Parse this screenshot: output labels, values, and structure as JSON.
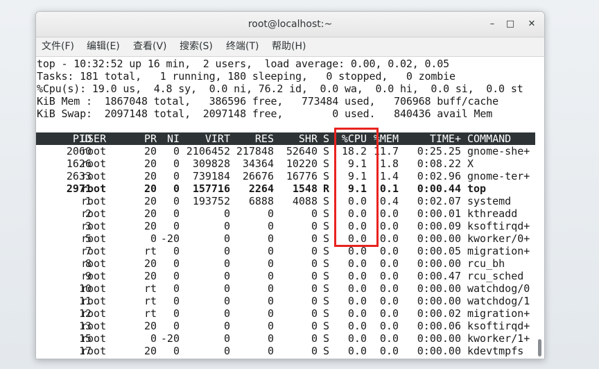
{
  "window": {
    "title": "root@localhost:~",
    "minimize_glyph": "–",
    "maximize_glyph": "□",
    "close_glyph": "✕"
  },
  "menu": [
    {
      "label": "文件(F)"
    },
    {
      "label": "编辑(E)"
    },
    {
      "label": "查看(V)"
    },
    {
      "label": "搜索(S)"
    },
    {
      "label": "终端(T)"
    },
    {
      "label": "帮助(H)"
    }
  ],
  "summary": [
    "top - 10:32:52 up 16 min,  2 users,  load average: 0.00, 0.02, 0.05",
    "Tasks: 181 total,   1 running, 180 sleeping,   0 stopped,   0 zombie",
    "%Cpu(s): 19.0 us,  4.8 sy,  0.0 ni, 76.2 id,  0.0 wa,  0.0 hi,  0.0 si,  0.0 st",
    "KiB Mem :  1867048 total,   386596 free,   773484 used,   706968 buff/cache",
    "KiB Swap:  2097148 total,  2097148 free,        0 used.   840436 avail Mem"
  ],
  "columns": [
    "PID",
    "USER",
    "PR",
    "NI",
    "VIRT",
    "RES",
    "SHR",
    "S",
    "%CPU",
    "%MEM",
    "TIME+",
    "COMMAND"
  ],
  "processes": [
    {
      "pid": "2060",
      "user": "root",
      "pr": "20",
      "ni": "0",
      "virt": "2106452",
      "res": "217848",
      "shr": "52640",
      "s": "S",
      "cpu": "18.2",
      "mem": "11.7",
      "time": "0:25.25",
      "cmd": "gnome-she+",
      "bold": false
    },
    {
      "pid": "1626",
      "user": "root",
      "pr": "20",
      "ni": "0",
      "virt": "309828",
      "res": "34364",
      "shr": "10220",
      "s": "S",
      "cpu": "9.1",
      "mem": "1.8",
      "time": "0:08.22",
      "cmd": "X",
      "bold": false
    },
    {
      "pid": "2633",
      "user": "root",
      "pr": "20",
      "ni": "0",
      "virt": "739184",
      "res": "26676",
      "shr": "16776",
      "s": "S",
      "cpu": "9.1",
      "mem": "1.4",
      "time": "0:02.96",
      "cmd": "gnome-ter+",
      "bold": false
    },
    {
      "pid": "2971",
      "user": "root",
      "pr": "20",
      "ni": "0",
      "virt": "157716",
      "res": "2264",
      "shr": "1548",
      "s": "R",
      "cpu": "9.1",
      "mem": "0.1",
      "time": "0:00.44",
      "cmd": "top",
      "bold": true
    },
    {
      "pid": "1",
      "user": "root",
      "pr": "20",
      "ni": "0",
      "virt": "193752",
      "res": "6888",
      "shr": "4088",
      "s": "S",
      "cpu": "0.0",
      "mem": "0.4",
      "time": "0:02.07",
      "cmd": "systemd",
      "bold": false
    },
    {
      "pid": "2",
      "user": "root",
      "pr": "20",
      "ni": "0",
      "virt": "0",
      "res": "0",
      "shr": "0",
      "s": "S",
      "cpu": "0.0",
      "mem": "0.0",
      "time": "0:00.01",
      "cmd": "kthreadd",
      "bold": false
    },
    {
      "pid": "3",
      "user": "root",
      "pr": "20",
      "ni": "0",
      "virt": "0",
      "res": "0",
      "shr": "0",
      "s": "S",
      "cpu": "0.0",
      "mem": "0.0",
      "time": "0:00.09",
      "cmd": "ksoftirqd+",
      "bold": false
    },
    {
      "pid": "5",
      "user": "root",
      "pr": "0",
      "ni": "-20",
      "virt": "0",
      "res": "0",
      "shr": "0",
      "s": "S",
      "cpu": "0.0",
      "mem": "0.0",
      "time": "0:00.00",
      "cmd": "kworker/0+",
      "bold": false
    },
    {
      "pid": "7",
      "user": "root",
      "pr": "rt",
      "ni": "0",
      "virt": "0",
      "res": "0",
      "shr": "0",
      "s": "S",
      "cpu": "0.0",
      "mem": "0.0",
      "time": "0:00.05",
      "cmd": "migration+",
      "bold": false
    },
    {
      "pid": "8",
      "user": "root",
      "pr": "20",
      "ni": "0",
      "virt": "0",
      "res": "0",
      "shr": "0",
      "s": "S",
      "cpu": "0.0",
      "mem": "0.0",
      "time": "0:00.00",
      "cmd": "rcu_bh",
      "bold": false
    },
    {
      "pid": "9",
      "user": "root",
      "pr": "20",
      "ni": "0",
      "virt": "0",
      "res": "0",
      "shr": "0",
      "s": "S",
      "cpu": "0.0",
      "mem": "0.0",
      "time": "0:00.47",
      "cmd": "rcu_sched",
      "bold": false
    },
    {
      "pid": "10",
      "user": "root",
      "pr": "rt",
      "ni": "0",
      "virt": "0",
      "res": "0",
      "shr": "0",
      "s": "S",
      "cpu": "0.0",
      "mem": "0.0",
      "time": "0:00.00",
      "cmd": "watchdog/0",
      "bold": false
    },
    {
      "pid": "11",
      "user": "root",
      "pr": "rt",
      "ni": "0",
      "virt": "0",
      "res": "0",
      "shr": "0",
      "s": "S",
      "cpu": "0.0",
      "mem": "0.0",
      "time": "0:00.00",
      "cmd": "watchdog/1",
      "bold": false
    },
    {
      "pid": "12",
      "user": "root",
      "pr": "rt",
      "ni": "0",
      "virt": "0",
      "res": "0",
      "shr": "0",
      "s": "S",
      "cpu": "0.0",
      "mem": "0.0",
      "time": "0:00.02",
      "cmd": "migration+",
      "bold": false
    },
    {
      "pid": "13",
      "user": "root",
      "pr": "20",
      "ni": "0",
      "virt": "0",
      "res": "0",
      "shr": "0",
      "s": "S",
      "cpu": "0.0",
      "mem": "0.0",
      "time": "0:00.06",
      "cmd": "ksoftirqd+",
      "bold": false
    },
    {
      "pid": "15",
      "user": "root",
      "pr": "0",
      "ni": "-20",
      "virt": "0",
      "res": "0",
      "shr": "0",
      "s": "S",
      "cpu": "0.0",
      "mem": "0.0",
      "time": "0:00.00",
      "cmd": "kworker/1+",
      "bold": false
    },
    {
      "pid": "17",
      "user": "root",
      "pr": "20",
      "ni": "0",
      "virt": "0",
      "res": "0",
      "shr": "0",
      "s": "S",
      "cpu": "0.0",
      "mem": "0.0",
      "time": "0:00.00",
      "cmd": "kdevtmpfs",
      "bold": false
    }
  ],
  "colors": {
    "header_bg": "#2e3436",
    "highlight_border": "#e8231f"
  }
}
